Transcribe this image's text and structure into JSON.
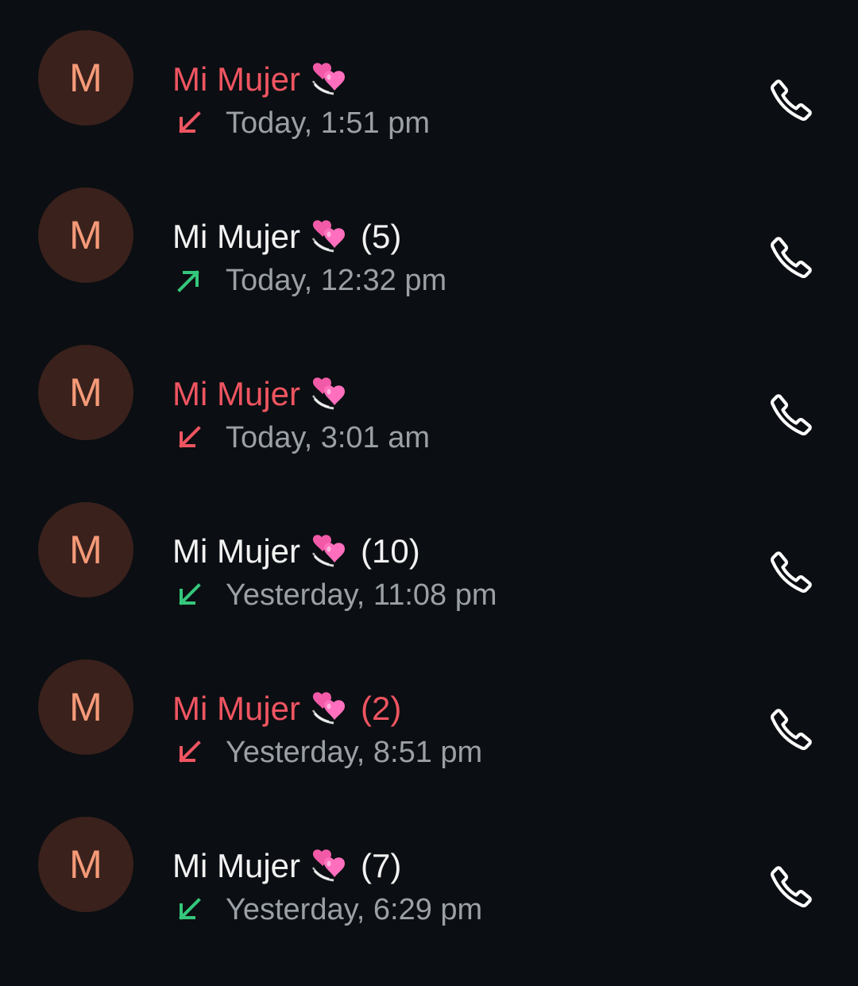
{
  "colors": {
    "background": "#0b0e12",
    "missed": "#ef5561",
    "answered": "#34c77b",
    "name_normal": "#f2f2f2",
    "time_text": "#9aa0a6",
    "avatar_bg": "#3a211c",
    "avatar_fg": "#f59a78"
  },
  "calls": [
    {
      "avatar_letter": "M",
      "name": "Mi Mujer",
      "emoji": "revolving-hearts-icon",
      "count": "",
      "missed": true,
      "direction": "incoming",
      "direction_icon": "arrow-down-left-icon",
      "time": "Today, 1:51 pm",
      "action_icon": "phone-icon"
    },
    {
      "avatar_letter": "M",
      "name": "Mi Mujer",
      "emoji": "revolving-hearts-icon",
      "count": "(5)",
      "missed": false,
      "direction": "outgoing",
      "direction_icon": "arrow-up-right-icon",
      "time": "Today, 12:32 pm",
      "action_icon": "phone-icon"
    },
    {
      "avatar_letter": "M",
      "name": "Mi Mujer",
      "emoji": "revolving-hearts-icon",
      "count": "",
      "missed": true,
      "direction": "incoming",
      "direction_icon": "arrow-down-left-icon",
      "time": "Today, 3:01 am",
      "action_icon": "phone-icon"
    },
    {
      "avatar_letter": "M",
      "name": "Mi Mujer",
      "emoji": "revolving-hearts-icon",
      "count": "(10)",
      "missed": false,
      "direction": "incoming",
      "direction_icon": "arrow-down-left-icon",
      "time": "Yesterday, 11:08 pm",
      "action_icon": "phone-icon"
    },
    {
      "avatar_letter": "M",
      "name": "Mi Mujer",
      "emoji": "revolving-hearts-icon",
      "count": "(2)",
      "missed": true,
      "direction": "incoming",
      "direction_icon": "arrow-down-left-icon",
      "time": "Yesterday, 8:51 pm",
      "action_icon": "phone-icon"
    },
    {
      "avatar_letter": "M",
      "name": "Mi Mujer",
      "emoji": "revolving-hearts-icon",
      "count": "(7)",
      "missed": false,
      "direction": "incoming",
      "direction_icon": "arrow-down-left-icon",
      "time": "Yesterday, 6:29 pm",
      "action_icon": "phone-icon"
    }
  ]
}
